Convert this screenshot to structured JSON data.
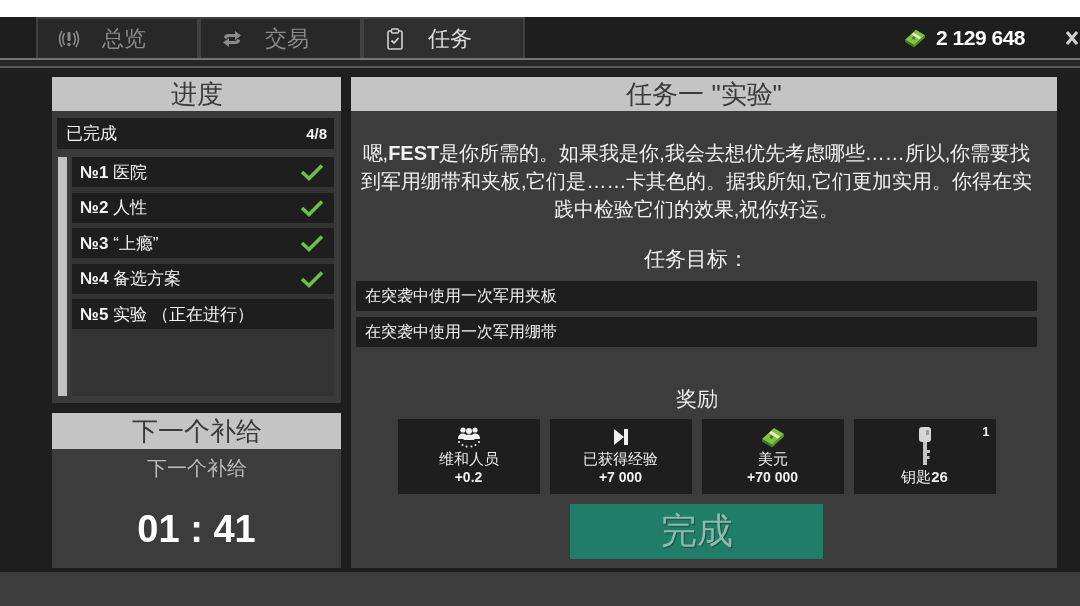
{
  "tabs": [
    {
      "label": "总览",
      "selected": false
    },
    {
      "label": "交易",
      "selected": false
    },
    {
      "label": "任务",
      "selected": true
    }
  ],
  "balance": "2 129 648",
  "progress": {
    "title": "进度",
    "completed_label": "已完成",
    "completed_count": "4/8",
    "quests": [
      {
        "label": "**№1** 医院",
        "completed": true
      },
      {
        "label": "**№2** 人性",
        "completed": true
      },
      {
        "label": "**№3** “上瘾”",
        "completed": true
      },
      {
        "label": "**№4** 备选方案",
        "completed": true
      },
      {
        "label": "**№5** 实验 （正在进行）",
        "completed": false
      }
    ]
  },
  "supply": {
    "title": "下一个补给",
    "label": "下一个补给",
    "timer": "01 : 41"
  },
  "quest": {
    "title": "任务一 \"实验\"",
    "description": "嗯,**FEST**是你所需的。如果我是你,我会去想优先考虑哪些……所以,你需要找到军用绷带和夹板,它们是……卡其色的。据我所知,它们更加实用。你得在实践中检验它们的效果,祝你好运。",
    "objectives_title": "任务目标：",
    "objectives": [
      "在突袭中使用一次军用夹板",
      "在突袭中使用一次军用绷带"
    ],
    "rewards_title": "奖励",
    "rewards": [
      {
        "kind": "reputation",
        "label": "维和人员",
        "value": "+0.2"
      },
      {
        "kind": "experience",
        "label": "已获得经验",
        "value": "+7 000"
      },
      {
        "kind": "money",
        "label": "美元",
        "value": "+70 000"
      },
      {
        "kind": "key",
        "label": "钥匙**26**",
        "count": "1"
      }
    ],
    "complete_button": {
      "label": "完成",
      "disabled": true
    }
  }
}
